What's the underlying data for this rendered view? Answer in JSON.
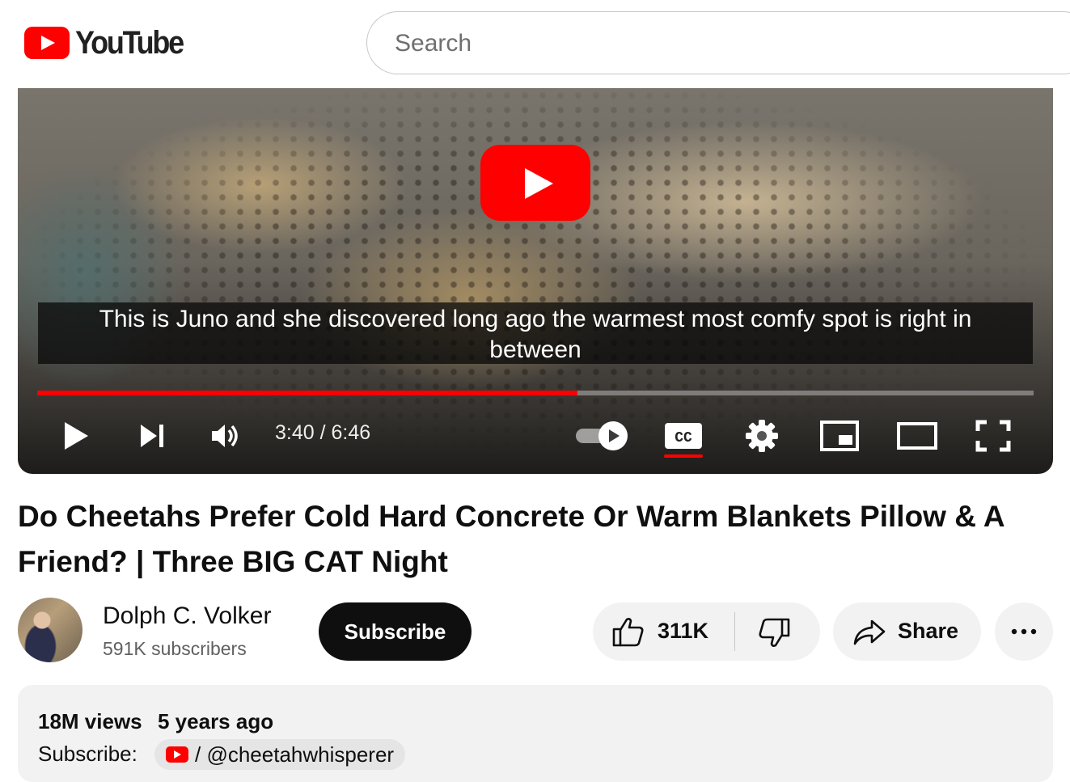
{
  "header": {
    "logo_text": "YouTube",
    "search_placeholder": "Search"
  },
  "player": {
    "caption": "This is Juno and she discovered long ago the warmest most comfy spot is right in between",
    "current_time": "3:40",
    "duration": "6:46",
    "time_display": "3:40 / 6:46",
    "progress_fraction": 0.542,
    "captions_on": true,
    "autoplay_on": true,
    "controls": [
      "play-icon",
      "next-icon",
      "volume-icon",
      "autoplay-toggle",
      "cc-icon",
      "settings-gear-icon",
      "miniplayer-icon",
      "theater-mode-icon",
      "fullscreen-icon"
    ]
  },
  "video": {
    "title": "Do Cheetahs Prefer Cold Hard Concrete Or Warm Blankets Pillow & A Friend? | Three BIG CAT Night"
  },
  "channel": {
    "name": "Dolph C. Volker",
    "subscribers": "591K subscribers",
    "subscribe_label": "Subscribe"
  },
  "actions": {
    "like_count": "311K",
    "share_label": "Share"
  },
  "description": {
    "views": "18M views",
    "age": "5 years ago",
    "subscribe_label": "Subscribe:",
    "handle": "/ @cheetahwhisperer"
  },
  "colors": {
    "brand_red": "#ff0000",
    "text": "#0f0f0f",
    "secondary_text": "#606060",
    "chip_bg": "#f2f2f2"
  }
}
